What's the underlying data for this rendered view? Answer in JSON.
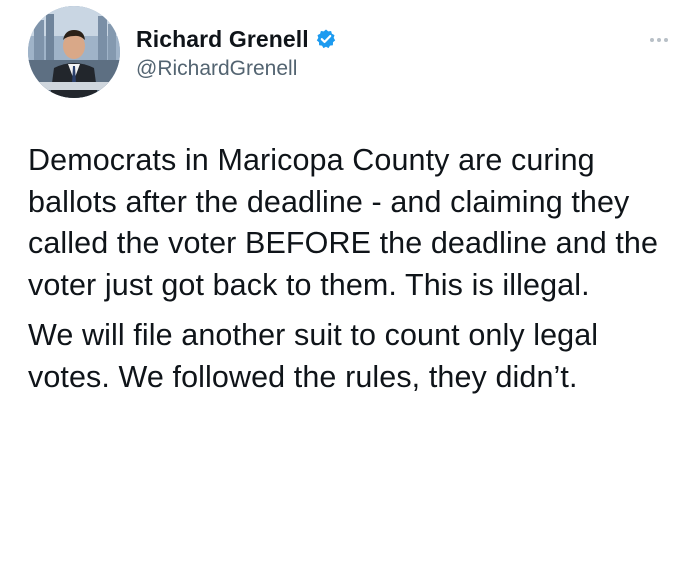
{
  "author": {
    "display_name": "Richard Grenell",
    "handle": "@RichardGrenell",
    "verified": true,
    "avatar_icon": "profile-photo"
  },
  "menu": {
    "icon": "more-options-icon"
  },
  "tweet": {
    "paragraphs": [
      "Democrats in Maricopa County are curing ballots after the deadline - and claiming they called the voter BEFORE the deadline and the voter just got back to them. This is illegal.",
      "We will file another suit to count only legal votes. We followed the rules, they didn’t."
    ]
  },
  "colors": {
    "verified_badge": "#1d9bf0",
    "name_text": "#0f1419",
    "handle_text": "#536471",
    "more_dots": "#b8c0c7"
  }
}
